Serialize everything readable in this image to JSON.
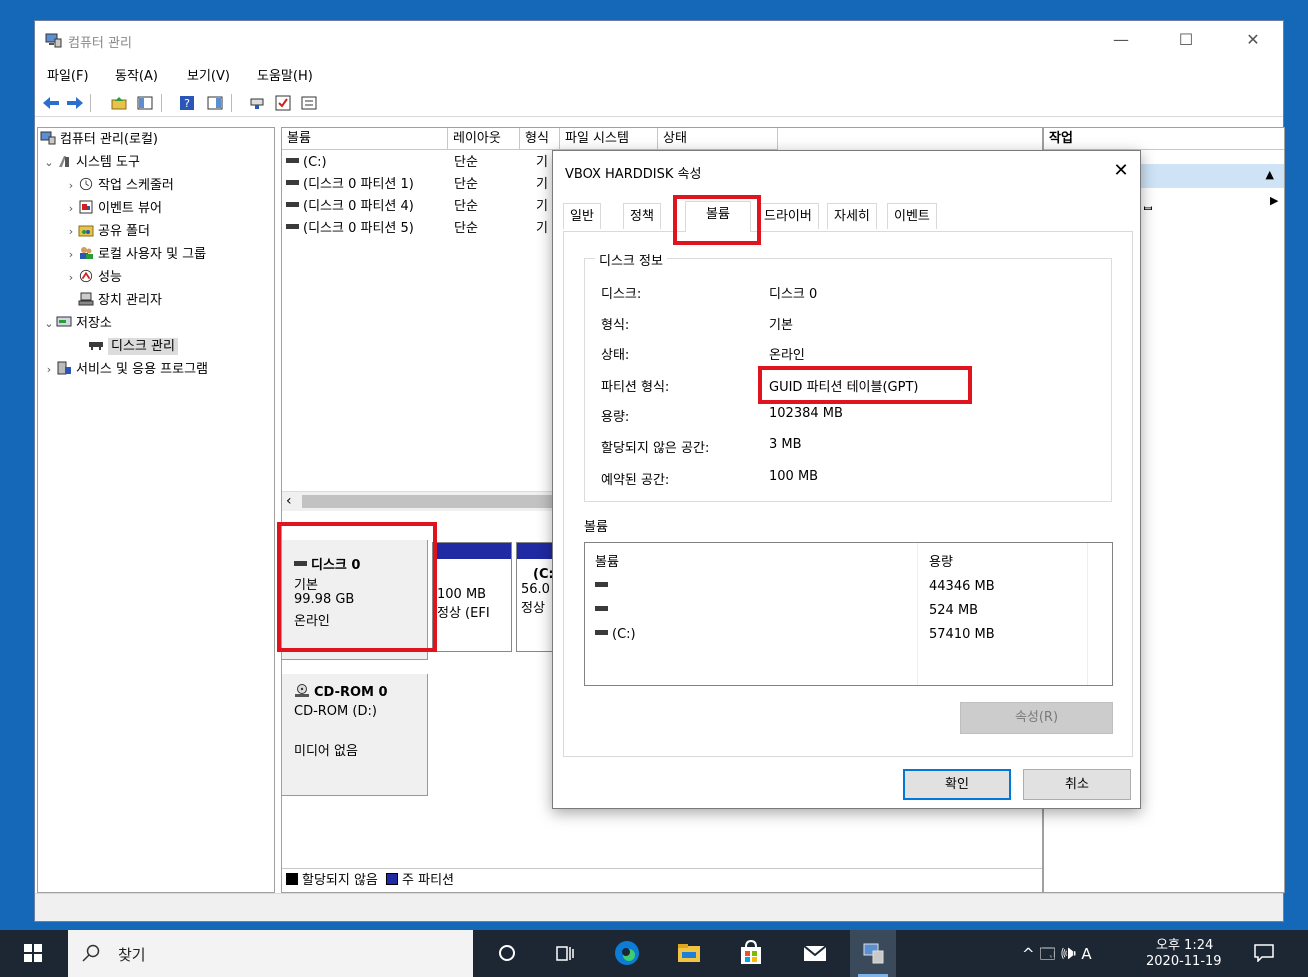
{
  "window": {
    "title": "컴퓨터 관리",
    "minimize": "—",
    "maximize": "☐",
    "close": "✕"
  },
  "menu": [
    "파일(F)",
    "동작(A)",
    "보기(V)",
    "도움말(H)"
  ],
  "tree": {
    "root": "컴퓨터 관리(로컬)",
    "system_tools": "시스템 도구",
    "task_scheduler": "작업 스케줄러",
    "event_viewer": "이벤트 뷰어",
    "shared_folders": "공유 폴더",
    "local_users": "로컬 사용자 및 그룹",
    "performance": "성능",
    "device_manager": "장치 관리자",
    "storage": "저장소",
    "disk_management": "디스크 관리",
    "services": "서비스 및 응용 프로그램"
  },
  "volumes_table": {
    "headers": [
      "볼륨",
      "레이아웃",
      "형식",
      "파일 시스템",
      "상태"
    ],
    "rows": [
      {
        "name": "(C:)",
        "layout": "단순",
        "type": "기"
      },
      {
        "name": "(디스크 0 파티션 1)",
        "layout": "단순",
        "type": "기"
      },
      {
        "name": "(디스크 0 파티션 4)",
        "layout": "단순",
        "type": "기"
      },
      {
        "name": "(디스크 0 파티션 5)",
        "layout": "단순",
        "type": "기"
      }
    ]
  },
  "disk0": {
    "name": "디스크 0",
    "type": "기본",
    "size": "99.98 GB",
    "status": "온라인",
    "partitions": [
      {
        "size": "100 MB",
        "status": "정상 (EFI"
      },
      {
        "name": "(C:",
        "size": "56.0",
        "status": "정상"
      }
    ]
  },
  "cdrom0": {
    "name": "CD-ROM 0",
    "drive": "CD-ROM (D:)",
    "media": "미디어 없음"
  },
  "legend": {
    "unallocated": "할당되지 않음",
    "primary": "주 파티션"
  },
  "action_pane": {
    "header": "작업",
    "item_fragment": "ᆸ"
  },
  "dialog": {
    "title": "VBOX HARDDISK 속성",
    "close": "✕",
    "tabs": [
      "일반",
      "정책",
      "볼륨",
      "드라이버",
      "자세히",
      "이벤트"
    ],
    "active_tab": "볼륨",
    "disk_info_legend": "디스크 정보",
    "info": [
      {
        "label": "디스크:",
        "value": "디스크 0"
      },
      {
        "label": "형식:",
        "value": "기본"
      },
      {
        "label": "상태:",
        "value": "온라인"
      },
      {
        "label": "파티션 형식:",
        "value": "GUID 파티션 테이블(GPT)"
      },
      {
        "label": "용량:",
        "value": "102384 MB"
      },
      {
        "label": "할당되지 않은 공간:",
        "value": "3 MB"
      },
      {
        "label": "예약된 공간:",
        "value": "100 MB"
      }
    ],
    "volumes_label": "볼륨",
    "vol_headers": [
      "볼륨",
      "용량"
    ],
    "vol_rows": [
      {
        "name": "",
        "capacity": "44346 MB"
      },
      {
        "name": "",
        "capacity": "524 MB"
      },
      {
        "name": "(C:)",
        "capacity": "57410 MB"
      }
    ],
    "properties_button": "속성(R)",
    "ok": "확인",
    "cancel": "취소"
  },
  "taskbar": {
    "search": "찾기",
    "tray_text": "^ 🗔 🕪 A",
    "time": "오후 1:24",
    "date": "2020-11-19"
  },
  "colors": {
    "highlight_red": "#e0141e",
    "primary_partition": "#1f2aa3",
    "taskbar": "#1c2733",
    "desktop": "#1567b8"
  }
}
